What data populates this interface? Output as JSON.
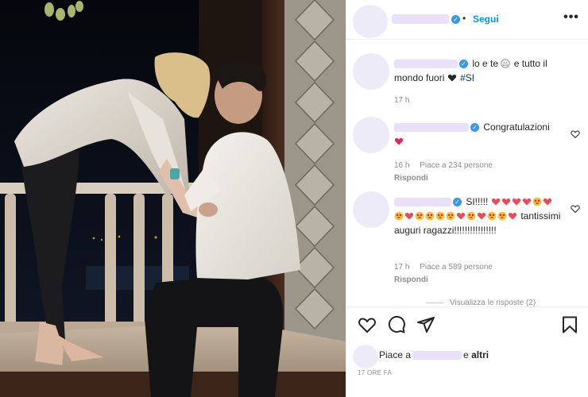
{
  "header": {
    "follow_label": "Segui",
    "separator": "•",
    "more_label": "•••",
    "verified_mark": "✓"
  },
  "comments": [
    {
      "text": "lo e te",
      "text_tail": "e tutto il mondo fuori",
      "hashtag": "#SI",
      "time": "17 h",
      "emoji": [
        "grimacing-face",
        "black-heart"
      ]
    },
    {
      "text": "Congratulazioni",
      "time": "16 h",
      "likes": "Piace a 234 persone",
      "reply_label": "Rispondi",
      "emoji": [
        "red-heart"
      ]
    },
    {
      "text": "SI!!!!!",
      "text_tail": "tantissimi auguri ragazzi!!!!!!!!!!!!!!!!",
      "time": "17 h",
      "likes": "Piace a 589 persone",
      "reply_label": "Rispondi",
      "emoji": [
        "red-heart",
        "heart-eyes-face"
      ]
    }
  ],
  "view_replies_label": "Visualizza le risposte (2)",
  "actions": {
    "icons": [
      "heart-icon",
      "comment-icon",
      "share-icon",
      "bookmark-icon"
    ]
  },
  "likes": {
    "prefix": "Piace a",
    "suffix": "e",
    "others": "altri"
  },
  "post_time": "17 ORE FA",
  "colors": {
    "accent": "#0095f6",
    "verified": "#3897f0",
    "heart": "#ed4956",
    "redacted": "#e9e1fa",
    "muted": "#8e8e8e"
  }
}
